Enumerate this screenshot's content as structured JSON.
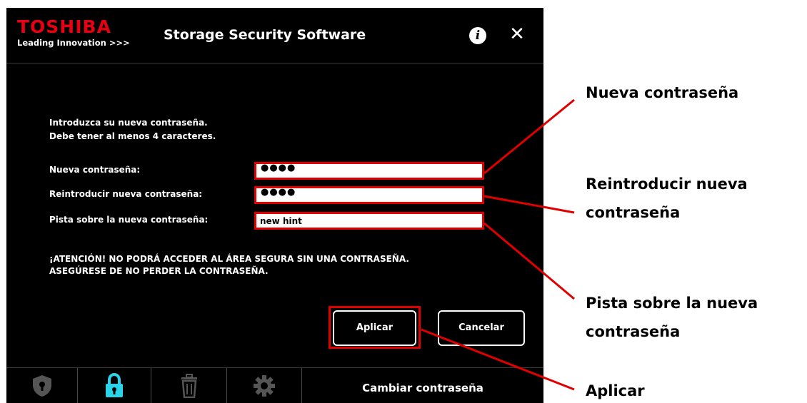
{
  "window": {
    "brand": {
      "name": "TOSHIBA",
      "tagline": "Leading Innovation >>>"
    },
    "title": "Storage Security Software",
    "info_icon": "info-icon",
    "close_icon": "close-icon"
  },
  "form": {
    "instructions": [
      "Introduzca su nueva contraseña.",
      "Debe tener al menos 4 caracteres."
    ],
    "fields": [
      {
        "label": "Nueva contraseña:",
        "value": "●●●●",
        "type": "password"
      },
      {
        "label": "Reintroducir nueva contraseña:",
        "value": "●●●●",
        "type": "password"
      },
      {
        "label": "Pista sobre la nueva contraseña:",
        "value": "new hint",
        "type": "text"
      }
    ],
    "warning": [
      "¡ATENCIÓN!  NO PODRÁ ACCEDER AL ÁREA SEGURA SIN UNA CONTRASEÑA.",
      "ASEGÚRESE DE NO PERDER LA CONTRASEÑA."
    ],
    "buttons": {
      "apply": "Aplicar",
      "cancel": "Cancelar"
    }
  },
  "bottom_nav": {
    "items": [
      {
        "icon": "shield-lock-icon",
        "active": false
      },
      {
        "icon": "padlock-icon",
        "active": true
      },
      {
        "icon": "trash-icon",
        "active": false
      },
      {
        "icon": "gear-icon",
        "active": false
      }
    ],
    "current_label": "Cambiar contraseña"
  },
  "annotations": [
    {
      "lines": [
        "Nueva contraseña"
      ]
    },
    {
      "lines": [
        "Reintroducir nueva",
        "contraseña"
      ]
    },
    {
      "lines": [
        "Pista sobre la nueva",
        "contraseña"
      ]
    },
    {
      "lines": [
        "Aplicar"
      ]
    }
  ],
  "colors": {
    "window_bg": "#000000",
    "brand_red": "#e60012",
    "highlight_red": "#e00000",
    "active_icon": "#29d3e8",
    "inactive_icon": "#555555"
  }
}
